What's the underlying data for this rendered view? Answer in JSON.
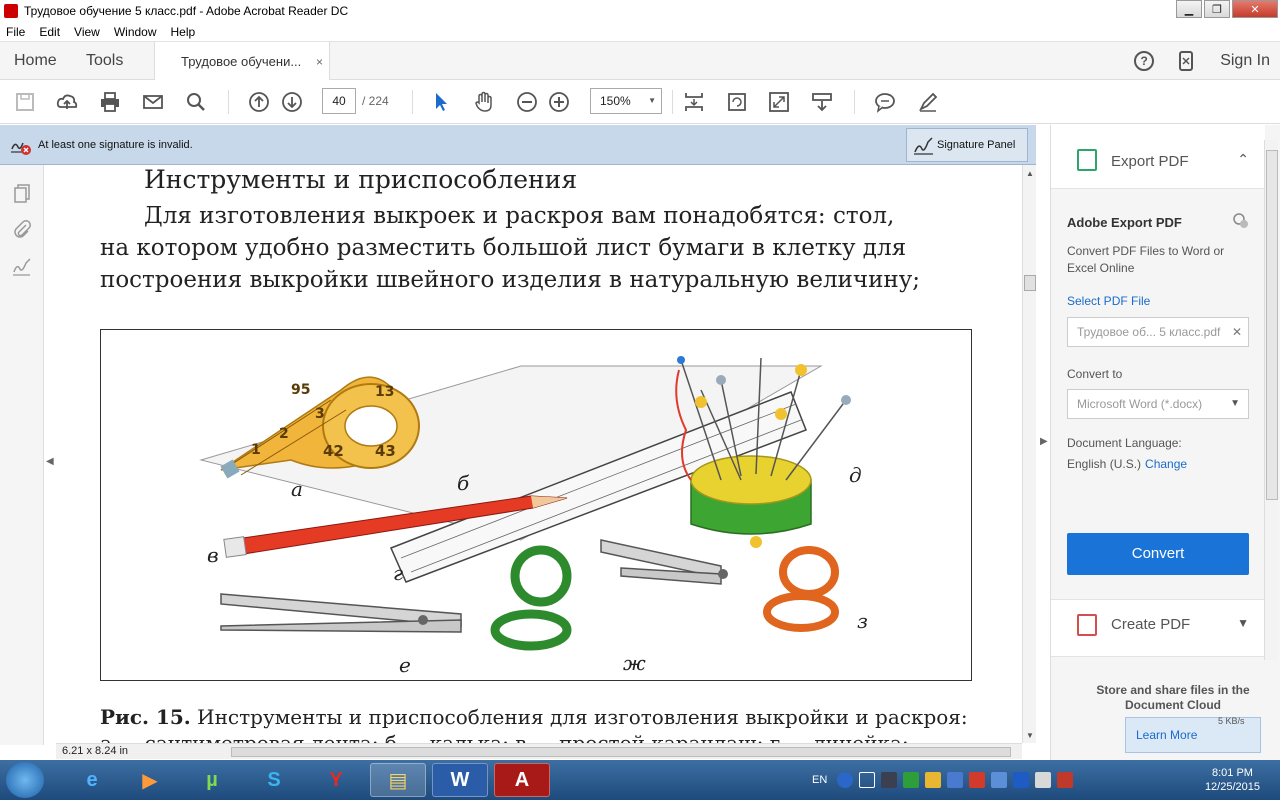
{
  "window": {
    "title": "Трудовое обучение 5 класс.pdf - Adobe Acrobat Reader DC",
    "minimize": "▁",
    "maximize": "❐",
    "close": "✕"
  },
  "menu": [
    "File",
    "Edit",
    "View",
    "Window",
    "Help"
  ],
  "tabs": {
    "home": "Home",
    "tools": "Tools",
    "document": "Трудовое обучени...",
    "close": "×",
    "help_icon": "?",
    "signin": "Sign In"
  },
  "toolbar": {
    "page_current": "40",
    "page_total": "/ 224",
    "zoom": "150%"
  },
  "signature_bar": {
    "message": "At least one signature is invalid.",
    "panel_button": "Signature Panel"
  },
  "document": {
    "heading": "Инструменты и приспособления",
    "para": [
      "Для изготовления выкроек и раскроя вам понадобятся: стол,",
      "на котором удобно разместить большой лист бумаги в клетку для",
      "построения выкройки швейного изделия в натуральную величину;"
    ],
    "figure_labels": {
      "a": "а",
      "b": "б",
      "v": "в",
      "g": "г",
      "d": "д",
      "e": "е",
      "zh": "ж",
      "z": "з"
    },
    "tape_numbers": [
      "95",
      "13",
      "2",
      "1",
      "42",
      "43",
      "3"
    ],
    "caption_bold": "Рис. 15.",
    "caption_text": " Инструменты и приспособления для изготовления выкройки и раскроя:",
    "caption_line2": "а — сантиметровая лента; б — калька; в — простой карандаш; г — линейка;",
    "dimensions": "6.21 x 8.24 in"
  },
  "right_panel": {
    "export_label": "Export PDF",
    "title": "Adobe Export PDF",
    "description": "Convert PDF Files to Word or Excel Online",
    "select_link": "Select PDF File",
    "file_name": "Трудовое об... 5 класс.pdf",
    "convert_to_label": "Convert to",
    "convert_to_value": "Microsoft Word (*.docx)",
    "language_label": "Document Language:",
    "language_value": "English (U.S.)",
    "language_change": "Change",
    "convert_button": "Convert",
    "create_label": "Create PDF",
    "store_text": "Store and share files in the Document Cloud",
    "learn_more": "Learn More",
    "net_speed": "5 KB/s"
  },
  "taskbar": {
    "lang": "EN",
    "time": "8:01 PM",
    "date": "12/25/2015",
    "apps": [
      "e",
      "▶",
      "µ",
      "S",
      "Y",
      "▤",
      "W",
      "A"
    ],
    "tray_icons": [
      "help-icon",
      "arrow-icon",
      "icon-b",
      "check-icon",
      "shield-icon",
      "network-icon",
      "flag-icon",
      "monitor-icon",
      "bluetooth-icon",
      "volume-icon",
      "flag2-icon"
    ]
  }
}
